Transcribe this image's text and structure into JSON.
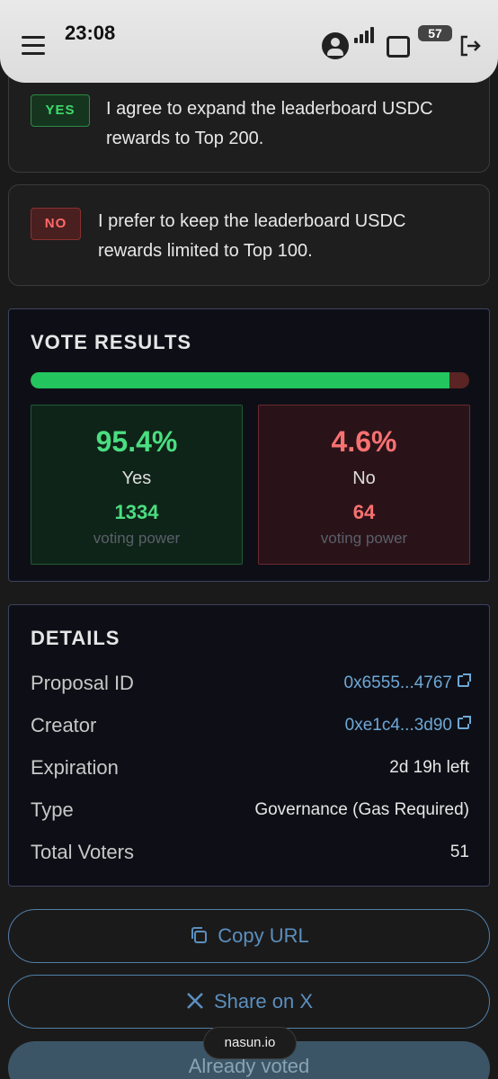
{
  "status_bar": {
    "time": "23:08",
    "battery": "57"
  },
  "options": [
    {
      "tag": "YES",
      "text_line1": "I agree to expand the leaderboard USDC",
      "text_line2": "rewards to Top 200."
    },
    {
      "tag": "NO",
      "text_line1": "I prefer to keep the leaderboard USDC",
      "text_line2": "rewards limited to Top 100."
    }
  ],
  "vote_results": {
    "title": "VOTE RESULTS",
    "yes_fraction": 0.954,
    "yes": {
      "pct": "95.4%",
      "label": "Yes",
      "power": "1334",
      "power_label": "voting power"
    },
    "no": {
      "pct": "4.6%",
      "label": "No",
      "power": "64",
      "power_label": "voting power"
    }
  },
  "details": {
    "title": "DETAILS",
    "rows": [
      {
        "key": "Proposal ID",
        "value": "0x6555...4767"
      },
      {
        "key": "Creator",
        "value": "0xe1c4...3d90"
      },
      {
        "key": "Expiration",
        "value": "2d 19h left"
      },
      {
        "key": "Type",
        "value": "Governance (Gas Required)"
      },
      {
        "key": "Total Voters",
        "value": "51"
      }
    ]
  },
  "buttons": {
    "copy_url": "Copy URL",
    "share": "Share on X",
    "voted": "Already voted"
  },
  "url_chip": "nasun.io",
  "colors": {
    "yes": "#4ade80",
    "no": "#f87171",
    "link": "#6ea8d6"
  }
}
